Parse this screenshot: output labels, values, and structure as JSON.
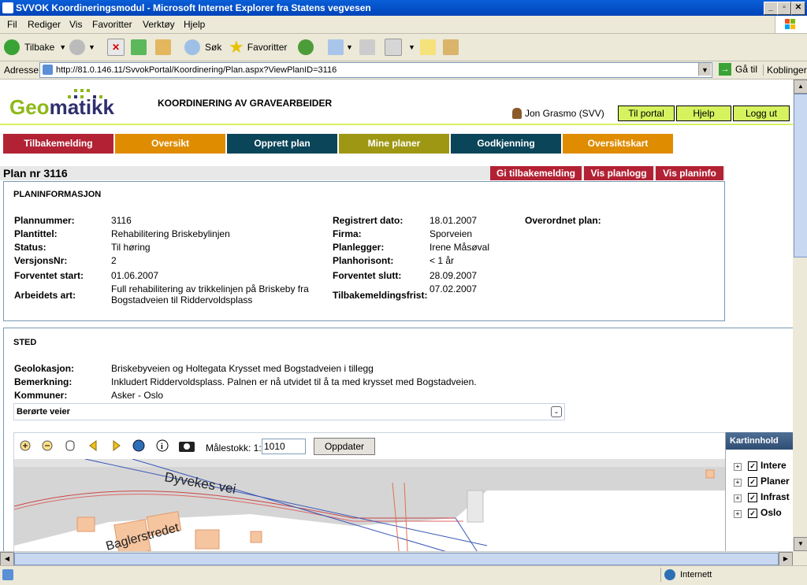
{
  "window": {
    "title": "SVVOK Koordineringsmodul - Microsoft Internet Explorer fra Statens vegvesen"
  },
  "menu": [
    "Fil",
    "Rediger",
    "Vis",
    "Favoritter",
    "Verktøy",
    "Hjelp"
  ],
  "toolbar": {
    "back": "Tilbake",
    "search": "Søk",
    "favorites": "Favoritter"
  },
  "address": {
    "label": "Adresse",
    "url": "http://81.0.146.11/SvvokPortal/Koordinering/Plan.aspx?ViewPlanID=3116",
    "go": "Gå til",
    "links": "Koblinger"
  },
  "header": {
    "logo_geo": "Geo",
    "logo_matikk": "matikk",
    "app_title": "KOORDINERING AV GRAVEARBEIDER",
    "user": "Jon Grasmo (SVV)",
    "buttons": [
      "Til portal",
      "Hjelp",
      "Logg ut"
    ]
  },
  "nav": [
    {
      "label": "Tilbakemelding",
      "color": "#b22234"
    },
    {
      "label": "Oversikt",
      "color": "#df8c00"
    },
    {
      "label": "Opprett plan",
      "color": "#0b4559"
    },
    {
      "label": "Mine planer",
      "color": "#9e9714"
    },
    {
      "label": "Godkjenning",
      "color": "#0b4559"
    },
    {
      "label": "Oversiktskart",
      "color": "#df8c00"
    }
  ],
  "plan": {
    "heading": "Plan nr 3116",
    "actions": [
      "Gi tilbakemelding",
      "Vis planlogg",
      "Vis planinfo"
    ]
  },
  "planinfo": {
    "title": "PLANINFORMASJON",
    "left": [
      {
        "label": "Plannummer:",
        "value": "3116"
      },
      {
        "label": "Plantittel:",
        "value": "Rehabilitering Briskebylinjen"
      },
      {
        "label": "Status:",
        "value": "Til høring"
      },
      {
        "label": "VersjonsNr:",
        "value": "2"
      },
      {
        "label": "Forventet start:",
        "value": "01.06.2007"
      },
      {
        "label": "Arbeidets art:",
        "value": "Full rehabilitering av trikkelinjen på Briskeby fra Bogstadveien til Riddervoldsplass"
      }
    ],
    "right": [
      {
        "label": "Registrert dato:",
        "value": "18.01.2007"
      },
      {
        "label": "Firma:",
        "value": "Sporveien"
      },
      {
        "label": "Planlegger:",
        "value": "Irene Måsøval"
      },
      {
        "label": "Planhorisont:",
        "value": "< 1 år"
      },
      {
        "label": "Forventet slutt:",
        "value": "28.09.2007"
      },
      {
        "label": "Tilbakemeldingsfrist:",
        "value": "07.02.2007"
      }
    ],
    "parent_label": "Overordnet plan:"
  },
  "sted": {
    "title": "STED",
    "rows": [
      {
        "label": "Geolokasjon:",
        "value": "Briskebyveien og Holtegata Krysset med Bogstadveien i tillegg"
      },
      {
        "label": "Bemerkning:",
        "value": "Inkludert Riddervoldsplass. Palnen er nå utvidet til å ta med krysset med Bogstadveien."
      },
      {
        "label": "Kommuner:",
        "value": "Asker - Oslo"
      }
    ],
    "roads": "Berørte veier"
  },
  "map": {
    "scale_label": "Målestokk: 1:",
    "scale_value": "1010",
    "update": "Oppdater",
    "street1": "Dyvekes vei",
    "street2": "Baglerstredet"
  },
  "kartinnhold": {
    "title": "Kartinnhold",
    "items": [
      "Intere",
      "Planer",
      "Infrast",
      "Oslo"
    ]
  },
  "status": {
    "zone": "Internett"
  }
}
